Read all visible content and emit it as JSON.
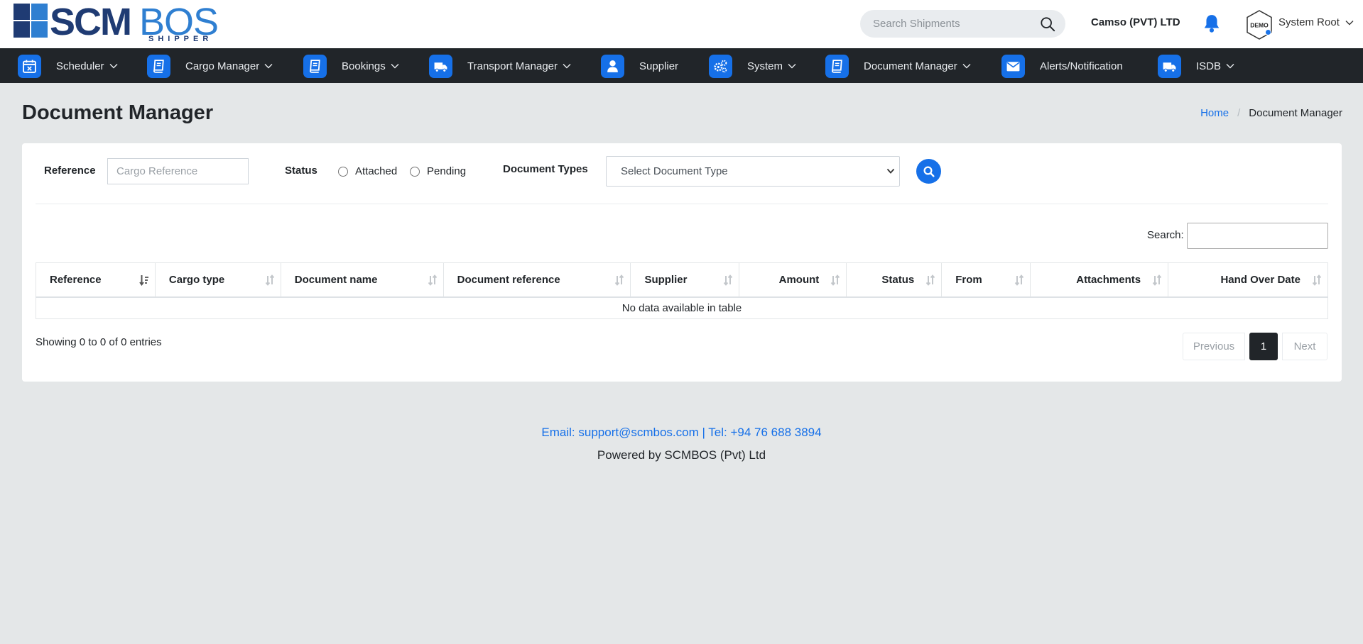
{
  "header": {
    "logo": {
      "scm": "SCM",
      "bos": "BOS",
      "sub": "SHIPPER"
    },
    "search": {
      "placeholder": "Search Shipments"
    },
    "company": "Camso (PVT) LTD",
    "avatar_text": "DEMO",
    "user": "System Root"
  },
  "colors": {
    "accent": "#1670e8",
    "nav_bg": "#212529",
    "logo_dark": "#1f3b73",
    "logo_light": "#2f7fd1",
    "page_bg": "#e4e7e8"
  },
  "nav": {
    "items": [
      {
        "label": "Scheduler",
        "icon": "calendar-icon",
        "dropdown": true
      },
      {
        "label": "Cargo Manager",
        "icon": "book-icon",
        "dropdown": true
      },
      {
        "label": "Bookings",
        "icon": "book-icon",
        "dropdown": true
      },
      {
        "label": "Transport Manager",
        "icon": "truck-icon",
        "dropdown": true
      },
      {
        "label": "Supplier",
        "icon": "user-icon",
        "dropdown": false
      },
      {
        "label": "System",
        "icon": "gears-icon",
        "dropdown": true
      },
      {
        "label": "Document Manager",
        "icon": "book-icon",
        "dropdown": true
      },
      {
        "label": "Alerts/Notification",
        "icon": "envelope-icon",
        "dropdown": false
      },
      {
        "label": "ISDB",
        "icon": "truck-icon",
        "dropdown": true
      }
    ]
  },
  "page": {
    "title": "Document Manager",
    "breadcrumb": {
      "home": "Home",
      "separator": "/",
      "current": "Document Manager"
    }
  },
  "filters": {
    "reference_label": "Reference",
    "reference_placeholder": "Cargo Reference",
    "status_label": "Status",
    "status_options": [
      "Attached",
      "Pending"
    ],
    "doc_types_label": "Document Types",
    "doc_types_selected": "Select Document Type"
  },
  "table": {
    "search_label": "Search:",
    "columns": [
      "Reference",
      "Cargo type",
      "Document name",
      "Document reference",
      "Supplier",
      "Amount",
      "Status",
      "From",
      "Attachments",
      "Hand Over Date"
    ],
    "empty_message": "No data available in table",
    "showing": "Showing 0 to 0 of 0 entries",
    "pagination": {
      "previous": "Previous",
      "page": "1",
      "next": "Next"
    }
  },
  "footer": {
    "contact": "Email: support@scmbos.com | Tel: +94 76 688 3894",
    "powered": "Powered by SCMBOS (Pvt) Ltd"
  }
}
